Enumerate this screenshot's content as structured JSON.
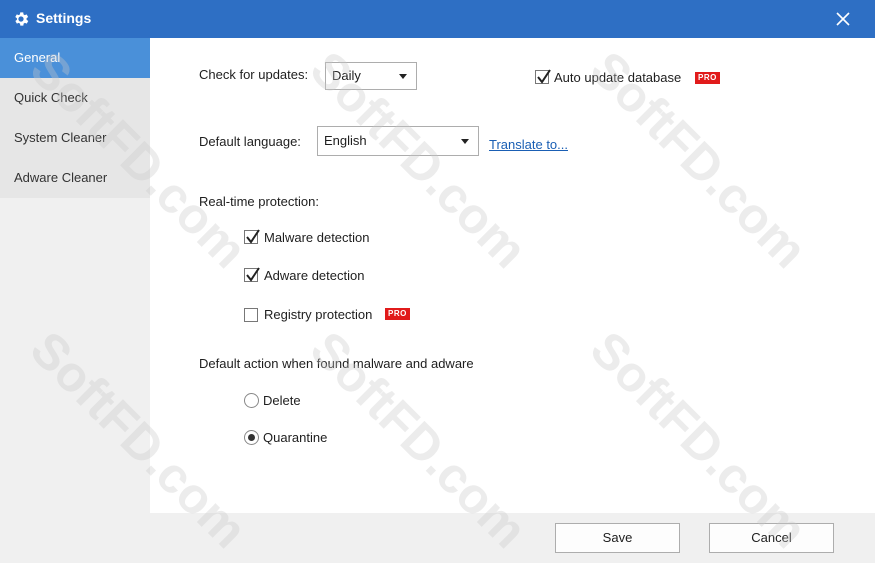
{
  "window": {
    "title": "Settings"
  },
  "sidebar": {
    "items": [
      {
        "label": "General",
        "active": true
      },
      {
        "label": "Quick Check",
        "active": false
      },
      {
        "label": "System Cleaner",
        "active": false
      },
      {
        "label": "Adware Cleaner",
        "active": false
      }
    ]
  },
  "general": {
    "check_updates_label": "Check for updates:",
    "check_updates_value": "Daily",
    "auto_update_label": "Auto update database",
    "auto_update_checked": true,
    "pro_badge": "PRO",
    "default_language_label": "Default language:",
    "default_language_value": "English",
    "translate_link": "Translate to...",
    "realtime_label": "Real-time protection:",
    "malware_detection_label": "Malware detection",
    "malware_detection_checked": true,
    "adware_detection_label": "Adware detection",
    "adware_detection_checked": true,
    "registry_protection_label": "Registry protection",
    "registry_protection_checked": false,
    "default_action_label": "Default action when found malware and adware",
    "action_delete_label": "Delete",
    "action_quarantine_label": "Quarantine",
    "selected_action": "Quarantine"
  },
  "footer": {
    "save_label": "Save",
    "cancel_label": "Cancel"
  },
  "watermark": "SoftFD.com",
  "colors": {
    "titlebar": "#2e6fc4",
    "active_sidebar": "#4a90d9",
    "pro_badge": "#e11b1b",
    "link": "#1a5fb4"
  },
  "icons": {
    "title": "gear-icon",
    "close": "close-icon",
    "dropdown": "chevron-down-icon",
    "check": "checkmark-icon"
  }
}
